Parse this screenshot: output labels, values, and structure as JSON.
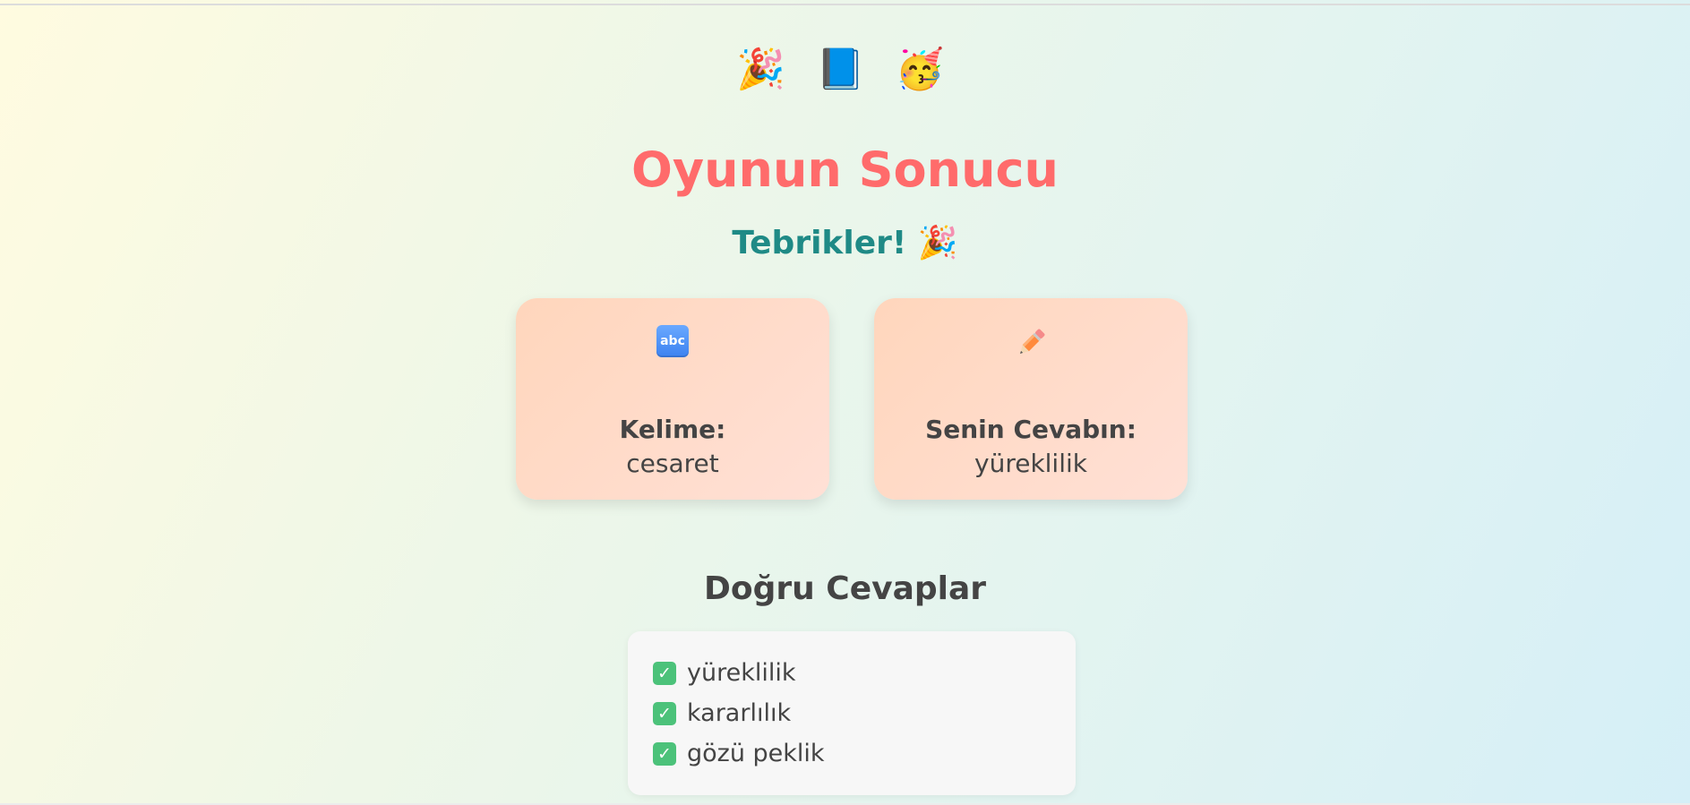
{
  "header": {
    "emojis": [
      "🎉",
      "📘",
      "🥳"
    ],
    "title": "Oyunun Sonucu",
    "subtitle": "Tebrikler! 🎉"
  },
  "cards": [
    {
      "icon": "abc-icon",
      "icon_text": "abc",
      "label": "Kelime:",
      "value": "cesaret"
    },
    {
      "icon": "pencil-icon",
      "label": "Senin Cevabın:",
      "value": "yüreklilik"
    }
  ],
  "correct_answers": {
    "heading": "Doğru Cevaplar",
    "icon": "check-icon",
    "items": [
      "yüreklilik",
      "kararlılık",
      "gözü peklik"
    ]
  },
  "colors": {
    "title": "#ff6b6b",
    "subtitle": "#1f8a86",
    "text": "#444444",
    "card_background": "#ffdcc8",
    "check": "#4cc27a"
  }
}
